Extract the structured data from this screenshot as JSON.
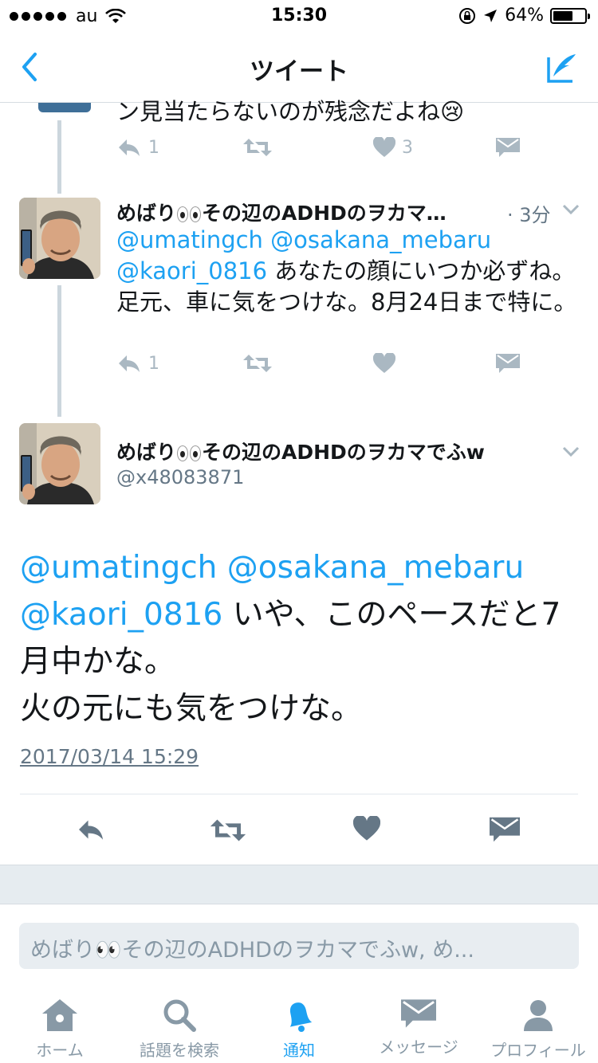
{
  "status_bar": {
    "carrier": "au",
    "time": "15:30",
    "battery": "64%",
    "battery_fraction": 0.64
  },
  "nav": {
    "title": "ツイート"
  },
  "prev_tweet": {
    "text_tail": "ン見当たらないのが残念だよね😢",
    "reply_count": "1",
    "retweet_count": "",
    "like_count": "3"
  },
  "tweet1": {
    "name_pre": "めばり",
    "name_post": "その辺のADHDのヲカマ…",
    "time": "· 3分",
    "mentions": [
      "@umatingch",
      "@osakana_mebaru",
      "@kaori_0816"
    ],
    "text_after_mentions": " あなたの顔にいつか必ずね。足元、車に気をつけな。8月24日まで特に。",
    "reply_count": "1"
  },
  "main_tweet": {
    "name_pre": "めばり",
    "name_post": "その辺のADHDのヲカマでふw",
    "handle": "@x48083871",
    "mentions": [
      "@umatingch",
      "@osakana_mebaru",
      "@kaori_0816"
    ],
    "text_line1": " いや、このペースだと7月中かな。",
    "text_line2": "火の元にも気をつけな。",
    "timestamp": "2017/03/14 15:29"
  },
  "reply_box": {
    "placeholder": "めばり👀その辺のADHDのヲカマでふw, め..."
  },
  "tabs": [
    {
      "label": "ホーム",
      "icon": "home-icon"
    },
    {
      "label": "話題を検索",
      "icon": "search-icon"
    },
    {
      "label": "通知",
      "icon": "bell-icon",
      "active": true
    },
    {
      "label": "メッセージ",
      "icon": "mail-icon"
    },
    {
      "label": "プロフィール",
      "icon": "person-icon"
    }
  ],
  "colors": {
    "accent": "#1da1f2",
    "muted": "#aab8c2",
    "text": "#14171a"
  }
}
